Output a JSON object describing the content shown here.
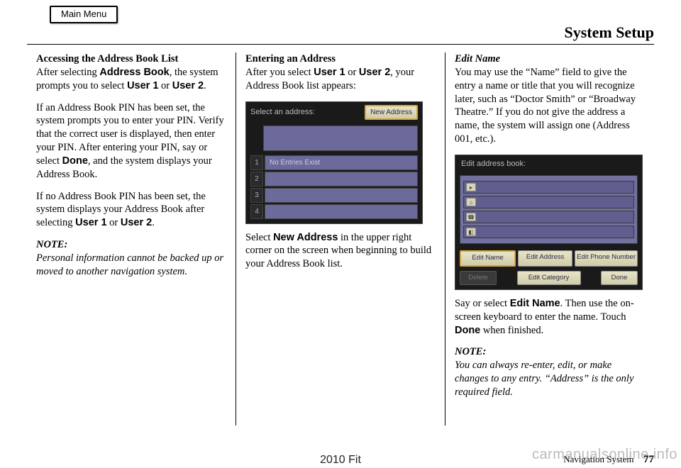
{
  "header": {
    "main_menu": "Main Menu",
    "page_title": "System Setup"
  },
  "col1": {
    "h1": "Accessing the Address Book List",
    "p1a": "After selecting ",
    "p1b": "Address Book",
    "p1c": ", the system prompts you to select ",
    "p1d": "User 1",
    "p1e": " or ",
    "p1f": "User 2",
    "p1g": ".",
    "p2a": "If an Address Book PIN has been set, the system prompts you to enter your PIN. Verify that the correct user is displayed, then enter your PIN. After entering your PIN, say or select ",
    "p2b": "Done",
    "p2c": ", and the system displays your Address Book.",
    "p3a": "If no Address Book PIN has been set, the system displays your Address Book after selecting ",
    "p3b": "User 1",
    "p3c": " or ",
    "p3d": "User 2",
    "p3e": ".",
    "note_label": "NOTE:",
    "note_text": "Personal information cannot be backed up or moved to another navigation system."
  },
  "col2": {
    "h1": "Entering an Address",
    "p1a": "After you select ",
    "p1b": "User 1",
    "p1c": " or ",
    "p1d": "User 2",
    "p1e": ", your Address Book list appears:",
    "screen": {
      "title": "Select an address:",
      "new_btn": "New Address",
      "rows": [
        "1",
        "2",
        "3",
        "4"
      ],
      "row1_text": "No Entries Exist"
    },
    "p2a": "Select ",
    "p2b": "New Address",
    "p2c": " in the upper right corner on the screen when beginning to build your Address Book list."
  },
  "col3": {
    "h1": "Edit Name",
    "p1": "You may use the “Name” field to give the entry a name or title that you will recognize later, such as “Doctor Smith” or “Broadway Theatre.” If you do not give the address a name, the system will assign one (Address 001, etc.).",
    "screen": {
      "title": "Edit address book:",
      "btn_edit_name": "Edit Name",
      "btn_edit_address": "Edit Address",
      "btn_edit_phone": "Edit Phone Number",
      "btn_delete": "Delete",
      "btn_edit_category": "Edit Category",
      "btn_done": "Done"
    },
    "p2a": "Say or select ",
    "p2b": "Edit Name",
    "p2c": ". Then use the on-screen keyboard to enter the name. Touch ",
    "p2d": "Done",
    "p2e": " when finished.",
    "note_label": "NOTE:",
    "note_text": "You can always re-enter, edit, or make changes to any entry. “Address” is the only required field."
  },
  "footer": {
    "center": "2010 Fit",
    "right_label": "Navigation System",
    "page_num": "77",
    "watermark": "carmanualsonline.info"
  }
}
